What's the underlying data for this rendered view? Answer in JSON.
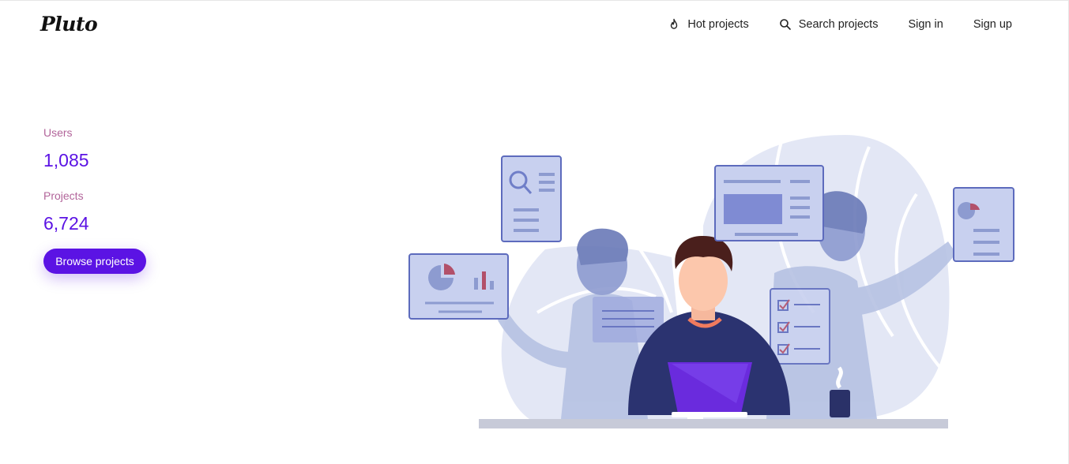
{
  "header": {
    "logo": "Pluto",
    "nav": {
      "hot_projects": "Hot projects",
      "search_projects": "Search projects",
      "sign_in": "Sign in",
      "sign_up": "Sign up"
    }
  },
  "stats": {
    "users_label": "Users",
    "users_value": "1,085",
    "projects_label": "Projects",
    "projects_value": "6,724"
  },
  "actions": {
    "browse_label": "Browse projects"
  },
  "colors": {
    "accent": "#5b13e4",
    "label": "#b2649a",
    "illustration_light": "#e3e7f5",
    "illustration_mid": "#aeb8e0",
    "illustration_dark": "#2f3a7a"
  },
  "icons": {
    "hot": "flame-icon",
    "search": "search-icon"
  }
}
